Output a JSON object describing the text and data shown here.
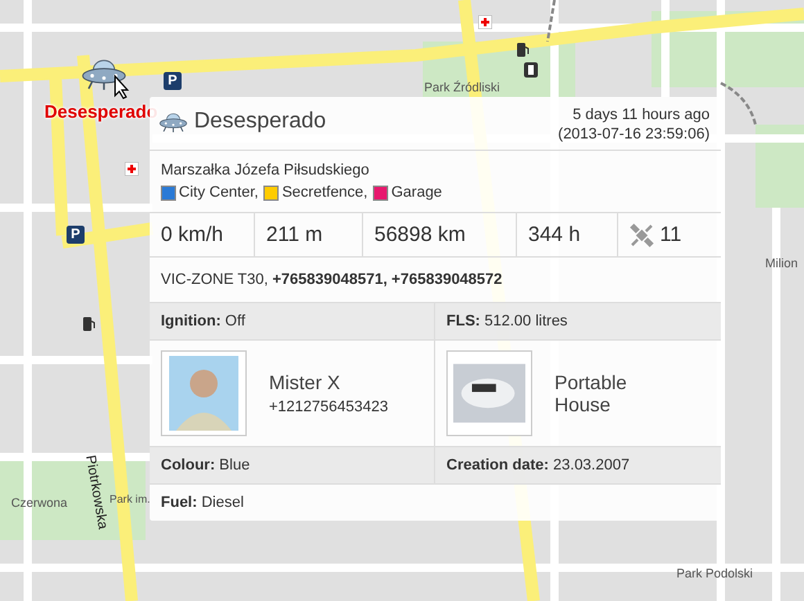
{
  "map": {
    "signs": [
      {
        "kind": "parking",
        "text": "P"
      },
      {
        "kind": "parking",
        "text": "P"
      }
    ],
    "labels": [
      {
        "text": "Park Źródliski",
        "kind": "normal"
      },
      {
        "text": "Milion",
        "kind": "normal"
      },
      {
        "text": "Czerwona",
        "kind": "normal"
      },
      {
        "text": "Piotrkowska",
        "kind": "vertical"
      },
      {
        "text": "Park im.",
        "kind": "normal"
      },
      {
        "text": "Park Podolski",
        "kind": "normal"
      }
    ]
  },
  "marker": {
    "label": "Desesperado"
  },
  "card": {
    "title": "Desesperado",
    "time_ago": "5 days 11 hours ago",
    "timestamp": "(2013-07-16 23:59:06)",
    "address": "Marszałka Józefa Piłsudskiego",
    "zones": [
      {
        "name": "City Center,",
        "color": "#2a7ad6"
      },
      {
        "name": "Secretfence,",
        "color": "#ffcc00"
      },
      {
        "name": "Garage",
        "color": "#e8186e"
      }
    ],
    "stats": [
      {
        "kind": "text",
        "value": "0 km/h"
      },
      {
        "kind": "text",
        "value": "211 m"
      },
      {
        "kind": "text",
        "value": "56898 km"
      },
      {
        "kind": "text",
        "value": "344 h"
      },
      {
        "kind": "satellites",
        "value": "11"
      }
    ],
    "device": "VIC-ZONE T30, **+765839048571, +765839048572**",
    "rows": [
      {
        "kind": "pair",
        "cells": [
          "**Ignition:** Off",
          "**FLS:** 512.00 litres"
        ]
      },
      {
        "kind": "people",
        "cells": [
          {
            "kind": "person",
            "name": "Mister X",
            "phone": "+1212756453423"
          },
          {
            "kind": "vehicle",
            "name": "Portable House"
          }
        ]
      },
      {
        "kind": "pair",
        "cells": [
          "**Colour:** Blue",
          "**Creation date:** 23.03.2007"
        ]
      },
      {
        "kind": "single",
        "cells": [
          "**Fuel:** Diesel"
        ]
      }
    ]
  }
}
